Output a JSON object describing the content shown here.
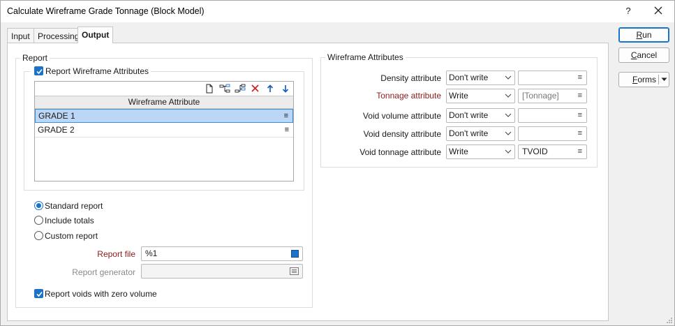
{
  "window": {
    "title": "Calculate Wireframe Grade Tonnage (Block Model)",
    "help": "?"
  },
  "tabs": [
    {
      "label": "Input"
    },
    {
      "label": "Processing"
    },
    {
      "label": "Output"
    }
  ],
  "report": {
    "legend": "Report",
    "report_wireframe_attributes": {
      "label": "Report Wireframe Attributes",
      "checked": true
    },
    "grid": {
      "column_header": "Wireframe Attribute",
      "rows": [
        {
          "value": "GRADE 1",
          "selected": true
        },
        {
          "value": "GRADE 2",
          "selected": false
        }
      ]
    },
    "options": [
      {
        "label": "Standard report",
        "selected": true
      },
      {
        "label": "Include totals",
        "selected": false
      },
      {
        "label": "Custom report",
        "selected": false
      }
    ],
    "report_file": {
      "label": "Report file",
      "value": "%1"
    },
    "report_generator": {
      "label": "Report generator",
      "value": ""
    },
    "report_voids": {
      "label": "Report voids with zero volume",
      "checked": true
    }
  },
  "wireframe_attributes": {
    "legend": "Wireframe Attributes",
    "rows": [
      {
        "label": "Density attribute",
        "mode": "Don't write",
        "value": "",
        "required": false
      },
      {
        "label": "Tonnage attribute",
        "mode": "Write",
        "value": "[Tonnage]",
        "required": true
      },
      {
        "label": "Void volume attribute",
        "mode": "Don't write",
        "value": "",
        "required": false
      },
      {
        "label": "Void density attribute",
        "mode": "Don't write",
        "value": "",
        "required": false
      },
      {
        "label": "Void tonnage attribute",
        "mode": "Write",
        "value": "TVOID",
        "required": false
      }
    ]
  },
  "buttons": {
    "run": "Run",
    "cancel": "Cancel",
    "forms": "Forms"
  },
  "colors": {
    "accent": "#1a73c8",
    "required_label": "#8b1a1a",
    "selection": "#bcd7f5"
  }
}
